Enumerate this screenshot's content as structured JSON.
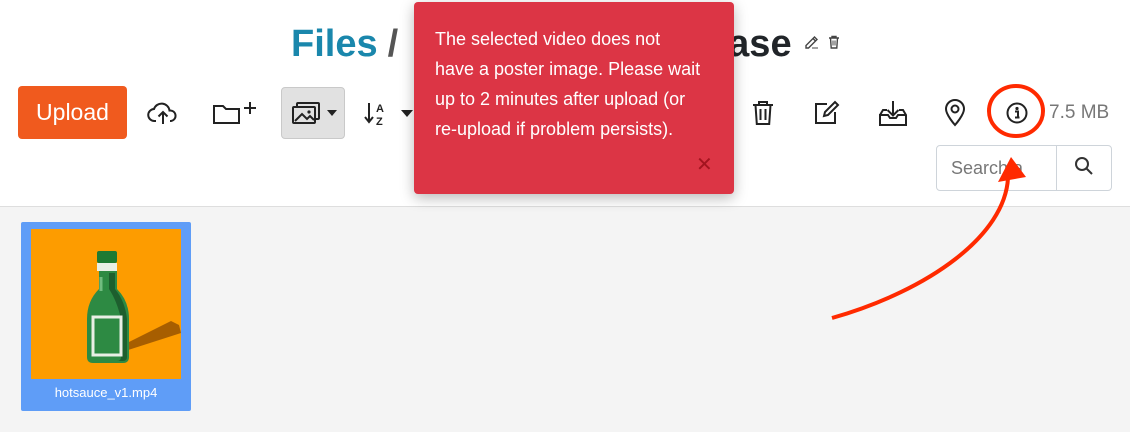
{
  "header": {
    "root_label": "Files",
    "separator": "/",
    "folder_name": "ase"
  },
  "toolbar": {
    "upload_label": "Upload",
    "storage_used": "7.5 MB",
    "icons": [
      "cloud-upload-icon",
      "new-folder-icon",
      "view-toggle-icon",
      "sort-az-icon",
      "trash-icon",
      "edit-icon",
      "download-icon",
      "location-pin-icon",
      "info-icon"
    ]
  },
  "search": {
    "placeholder": "Search a"
  },
  "toast": {
    "message": "The selected video does not have a poster image. Please wait up to 2 minutes after upload (or re-upload if problem persists).",
    "close_glyph": "✕"
  },
  "files": [
    {
      "name": "hotsauce_v1.mp4",
      "selected": true
    }
  ],
  "colors": {
    "brand": "#1a87ac",
    "upload": "#f05a1e",
    "toast": "#dc3545",
    "selection": "#5f9df7",
    "annotation": "#ff2a00"
  }
}
